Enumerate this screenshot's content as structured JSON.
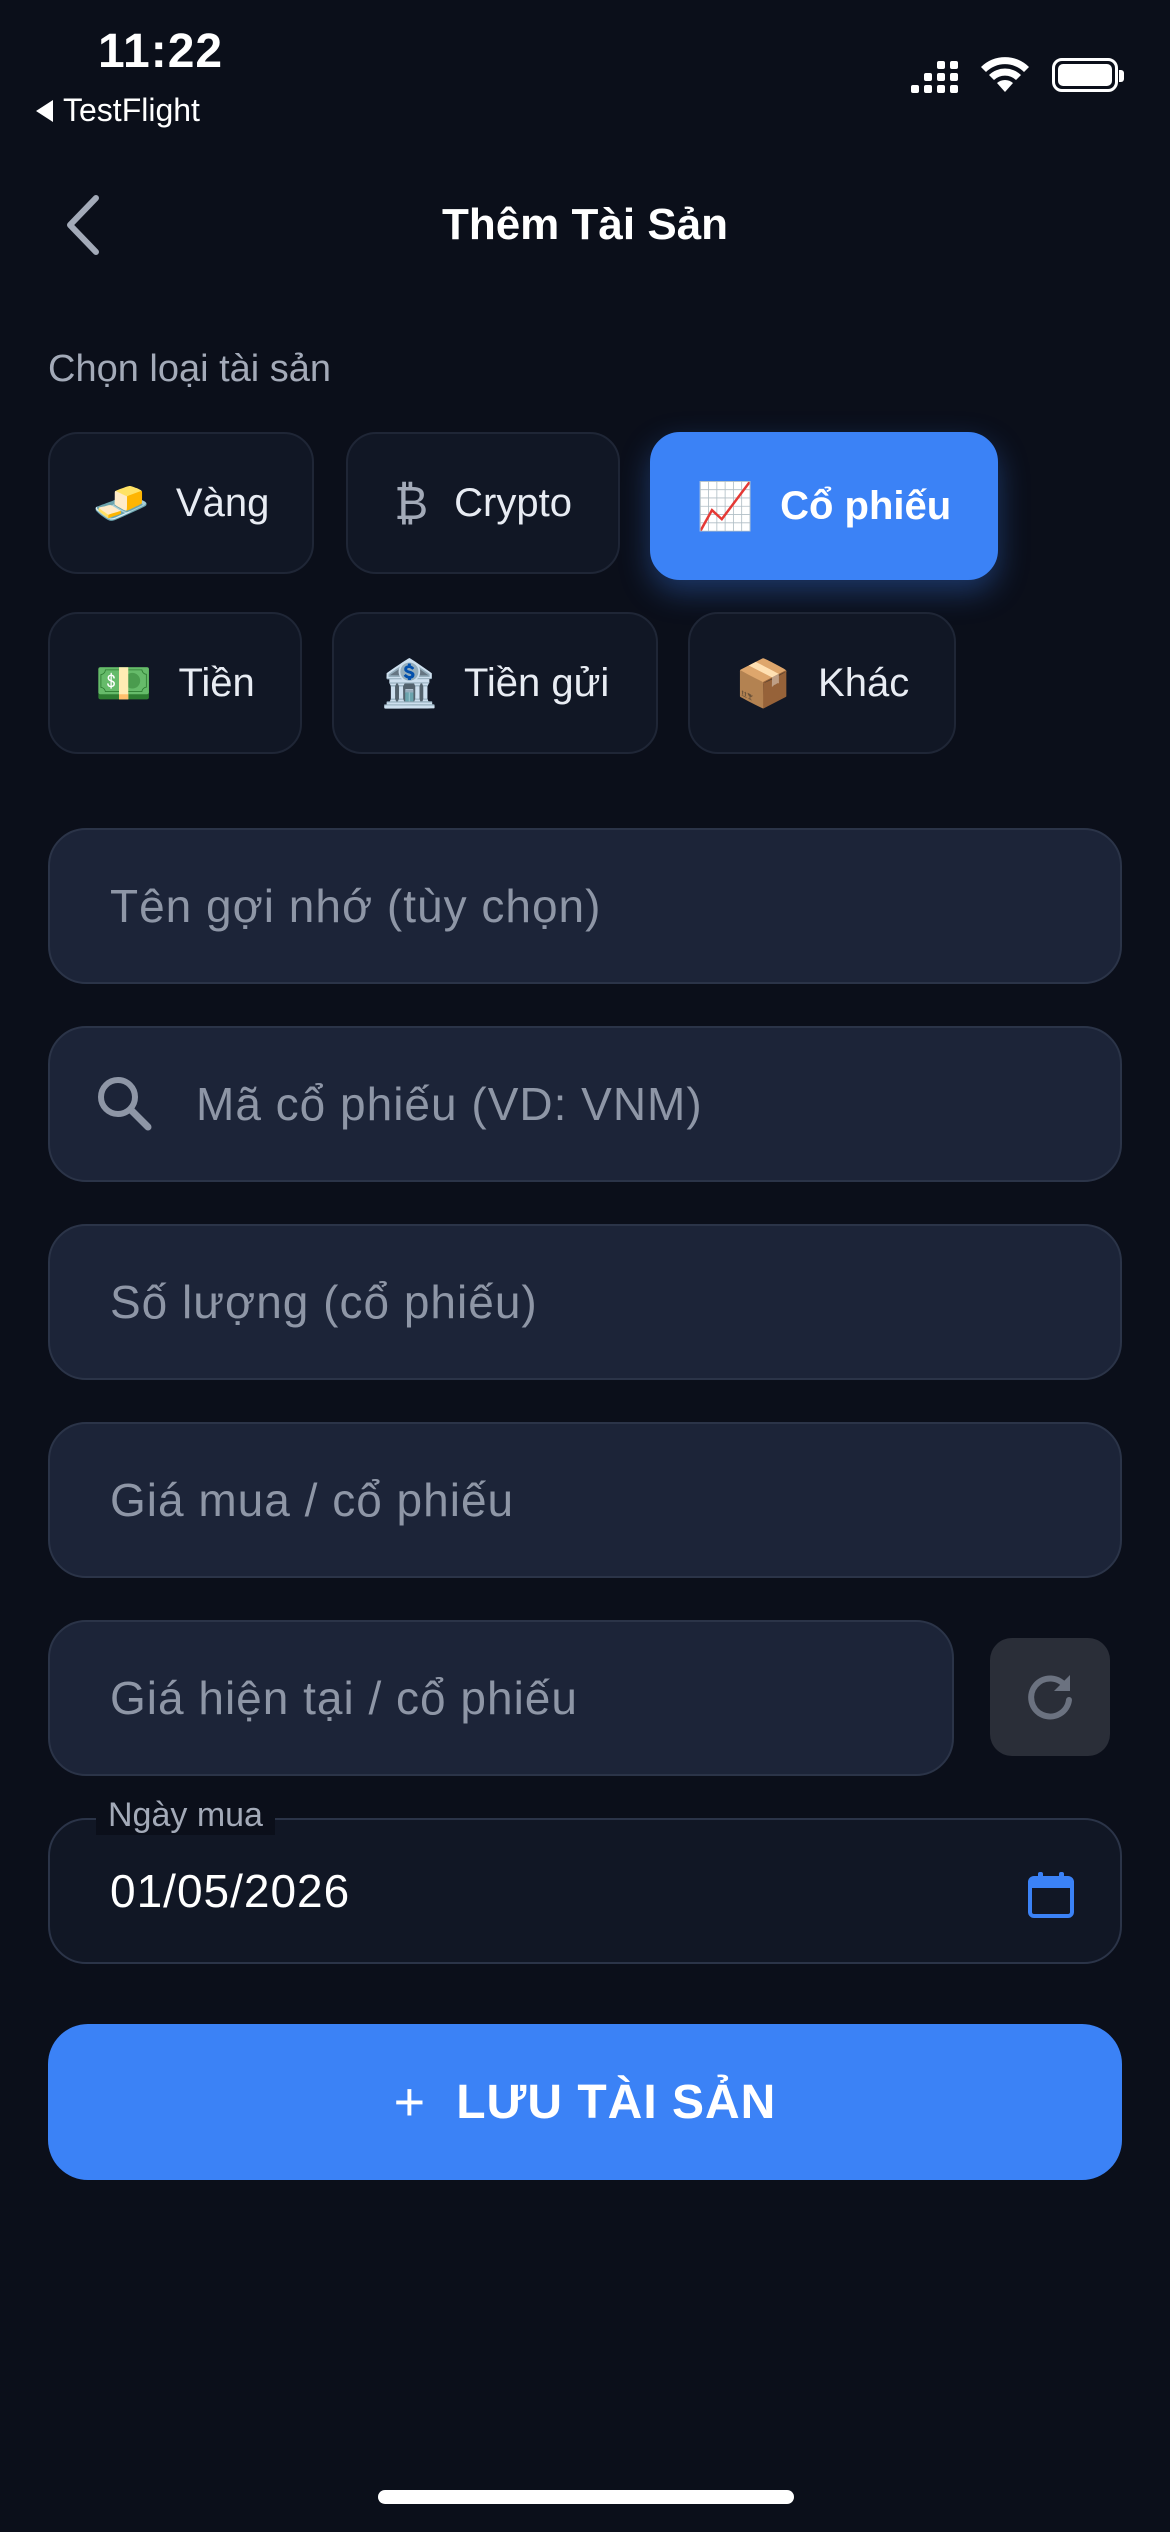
{
  "status_bar": {
    "time": "11:22",
    "back_app": "TestFlight"
  },
  "header": {
    "title": "Thêm Tài Sản"
  },
  "asset_type": {
    "label": "Chọn loại tài sản",
    "options": [
      {
        "icon": "gold-bars-icon",
        "emoji": "🧈",
        "label": "Vàng",
        "selected": false
      },
      {
        "icon": "bitcoin-icon",
        "emoji": "₿",
        "label": "Crypto",
        "selected": false
      },
      {
        "icon": "chart-increasing-icon",
        "emoji": "📈",
        "label": "Cổ phiếu",
        "selected": true
      },
      {
        "icon": "money-icon",
        "emoji": "💵",
        "label": "Tiền",
        "selected": false
      },
      {
        "icon": "bank-icon",
        "emoji": "🏦",
        "label": "Tiền gửi",
        "selected": false
      },
      {
        "icon": "package-icon",
        "emoji": "📦",
        "label": "Khác",
        "selected": false
      }
    ]
  },
  "form": {
    "name_placeholder": "Tên gợi nhớ (tùy chọn)",
    "ticker_placeholder": "Mã cổ phiếu (VD: VNM)",
    "quantity_placeholder": "Số lượng (cổ phiếu)",
    "buy_price_placeholder": "Giá mua / cổ phiếu",
    "current_price_placeholder": "Giá hiện tại / cổ phiếu",
    "purchase_date_label": "Ngày mua",
    "purchase_date_value": "01/05/2026"
  },
  "actions": {
    "save_label": "LƯU TÀI SẢN"
  },
  "colors": {
    "background": "#0b0f1a",
    "accent": "#3b82f6",
    "field_bg": "#1c2438"
  }
}
